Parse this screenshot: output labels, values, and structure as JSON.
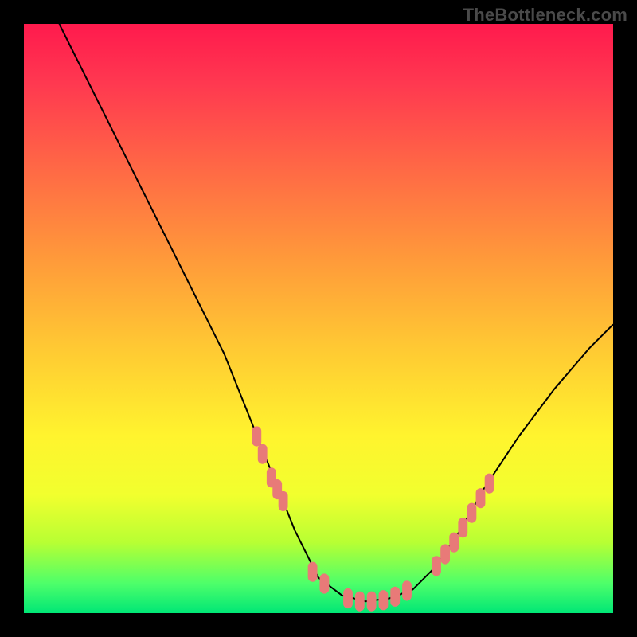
{
  "watermark": "TheBottleneck.com",
  "colors": {
    "background": "#000000",
    "curve": "#000000",
    "marker": "#e87a78",
    "gradient_top": "#ff1a4d",
    "gradient_bottom": "#00e676"
  },
  "chart_data": {
    "type": "line",
    "title": "",
    "xlabel": "",
    "ylabel": "",
    "xlim": [
      0,
      100
    ],
    "ylim": [
      0,
      100
    ],
    "note": "Values in percent of plot area; y measured from bottom. Curve is a bottleneck V-shape.",
    "series": [
      {
        "name": "curve",
        "points": [
          {
            "x": 6,
            "y": 100
          },
          {
            "x": 13,
            "y": 86
          },
          {
            "x": 20,
            "y": 72
          },
          {
            "x": 27,
            "y": 58
          },
          {
            "x": 34,
            "y": 44
          },
          {
            "x": 38,
            "y": 34
          },
          {
            "x": 42,
            "y": 24
          },
          {
            "x": 46,
            "y": 14
          },
          {
            "x": 50,
            "y": 6
          },
          {
            "x": 54,
            "y": 3
          },
          {
            "x": 58,
            "y": 2
          },
          {
            "x": 62,
            "y": 2.5
          },
          {
            "x": 66,
            "y": 4
          },
          {
            "x": 70,
            "y": 8
          },
          {
            "x": 74,
            "y": 14
          },
          {
            "x": 78,
            "y": 21
          },
          {
            "x": 84,
            "y": 30
          },
          {
            "x": 90,
            "y": 38
          },
          {
            "x": 96,
            "y": 45
          },
          {
            "x": 100,
            "y": 49
          }
        ]
      }
    ],
    "markers": [
      {
        "x": 39.5,
        "y": 30
      },
      {
        "x": 40.5,
        "y": 27
      },
      {
        "x": 42,
        "y": 23
      },
      {
        "x": 43,
        "y": 21
      },
      {
        "x": 44,
        "y": 19
      },
      {
        "x": 49,
        "y": 7
      },
      {
        "x": 51,
        "y": 5
      },
      {
        "x": 55,
        "y": 2.5
      },
      {
        "x": 57,
        "y": 2
      },
      {
        "x": 59,
        "y": 2
      },
      {
        "x": 61,
        "y": 2.2
      },
      {
        "x": 63,
        "y": 2.8
      },
      {
        "x": 65,
        "y": 3.8
      },
      {
        "x": 70,
        "y": 8
      },
      {
        "x": 71.5,
        "y": 10
      },
      {
        "x": 73,
        "y": 12
      },
      {
        "x": 74.5,
        "y": 14.5
      },
      {
        "x": 76,
        "y": 17
      },
      {
        "x": 77.5,
        "y": 19.5
      },
      {
        "x": 79,
        "y": 22
      }
    ],
    "marker_style": {
      "shape": "pill",
      "width_pct": 1.6,
      "height_pct": 3.4,
      "radius_pct": 0.8
    }
  }
}
